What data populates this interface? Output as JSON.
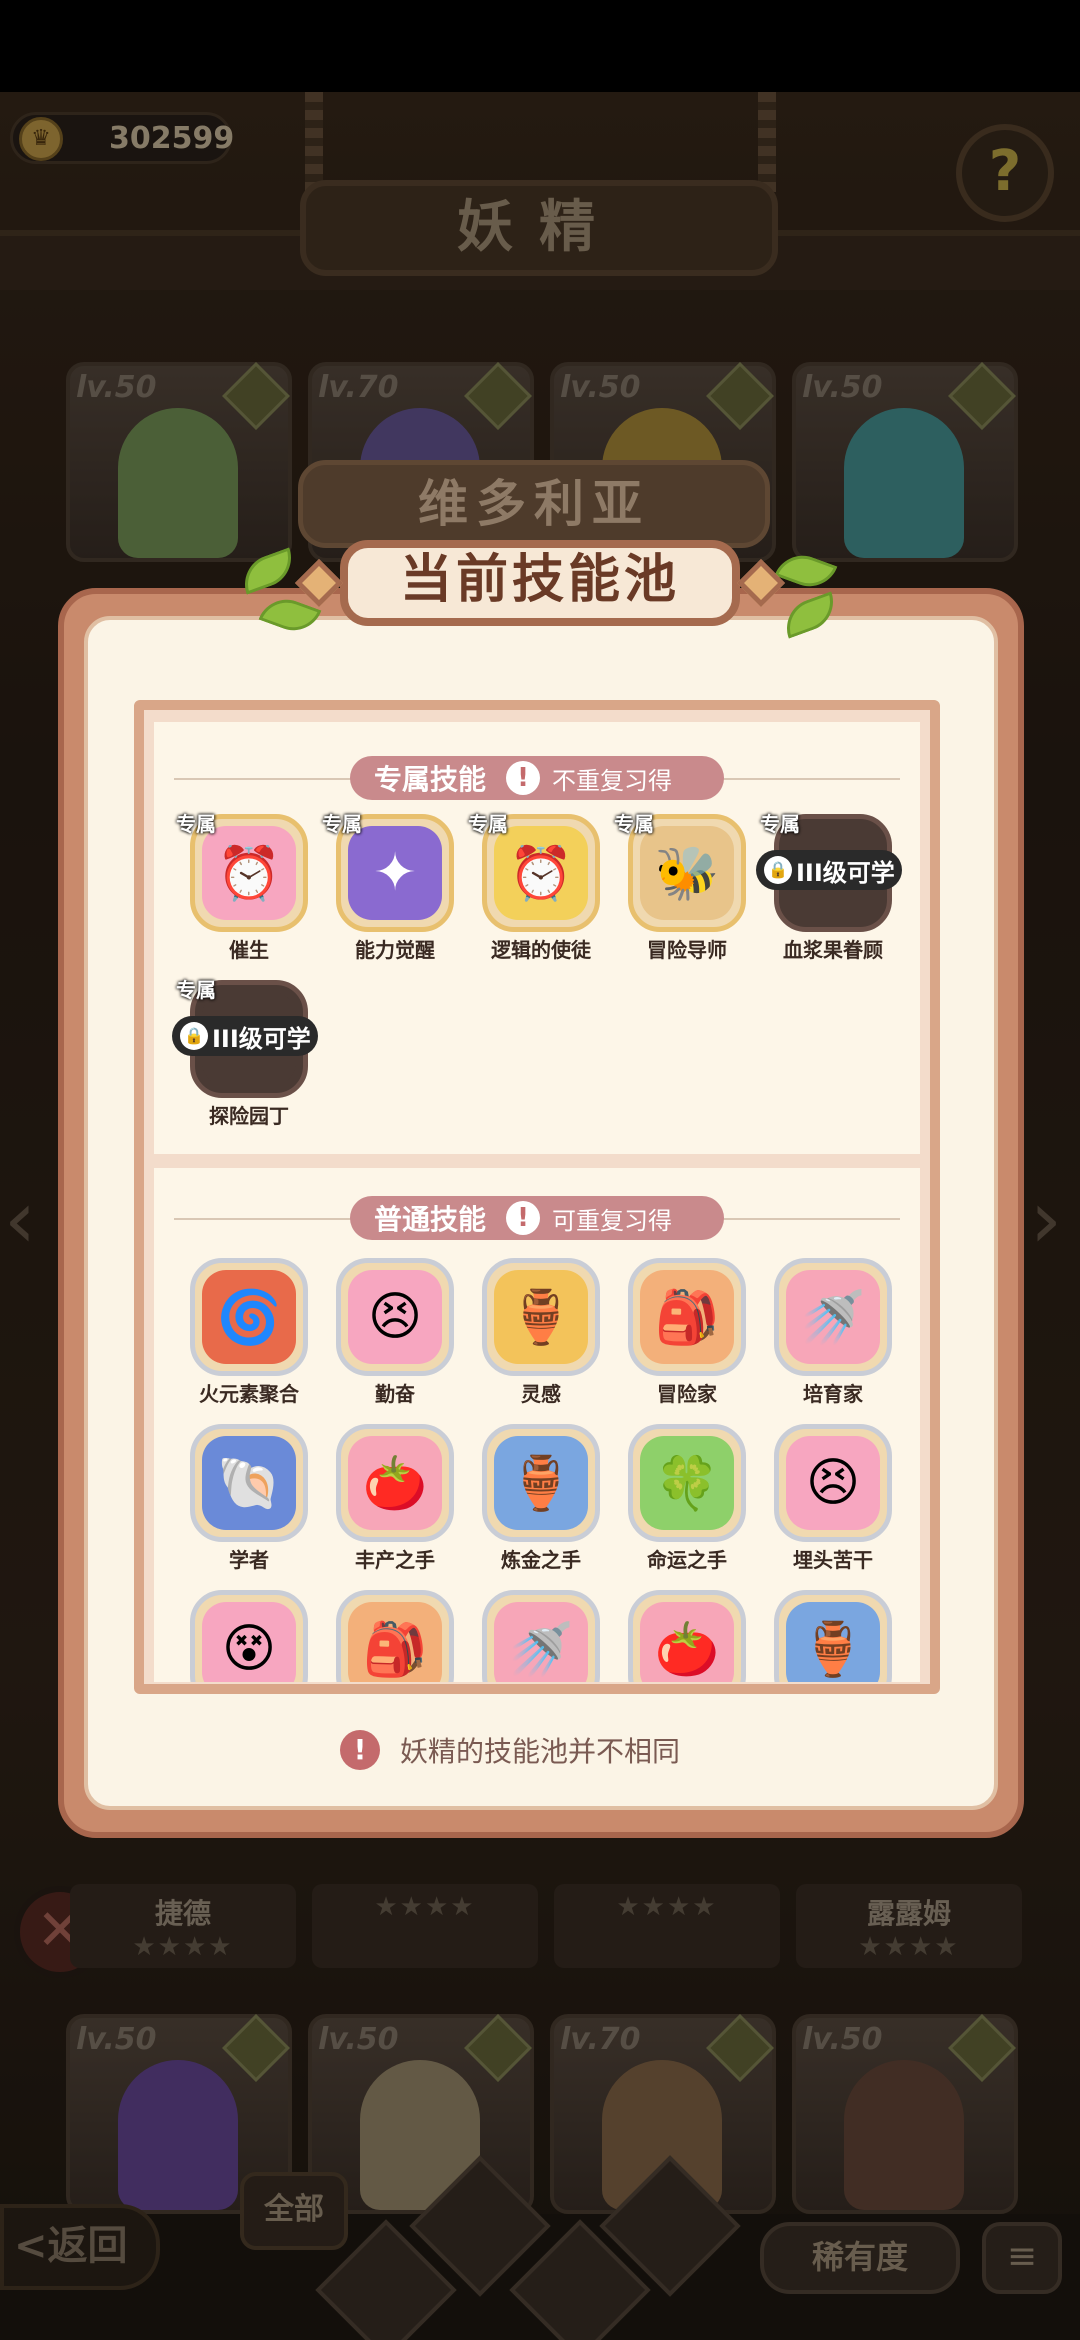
{
  "hud": {
    "coins": "302599",
    "page_title": "妖精"
  },
  "top_cards": [
    {
      "level": "lv.50"
    },
    {
      "level": "lv.70"
    },
    {
      "level": "lv.50"
    },
    {
      "level": "lv.50"
    }
  ],
  "bottom_cards": [
    {
      "level": "lv.50"
    },
    {
      "level": "lv.50"
    },
    {
      "level": "lv.70"
    },
    {
      "level": "lv.50"
    }
  ],
  "name_bars": [
    {
      "name": "捷德",
      "stars": "★★★★"
    },
    {
      "name": "",
      "stars": "★★★★"
    },
    {
      "name": "",
      "stars": "★★★★"
    },
    {
      "name": "露露姆",
      "stars": "★★★★"
    }
  ],
  "popup": {
    "character_name": "维多利亚",
    "title": "当前技能池",
    "exclusive": {
      "title": "专属技能",
      "note": "不重复习得",
      "tag": "专属",
      "lock_text": "III级可学",
      "skills": [
        {
          "label": "催生",
          "icon": "⏰",
          "bg": "#f7a6c0",
          "locked": false
        },
        {
          "label": "能力觉醒",
          "icon": "✦",
          "bg": "#8a6ad0",
          "locked": false
        },
        {
          "label": "逻辑的使徒",
          "icon": "⏰",
          "bg": "#f3d05a",
          "locked": false
        },
        {
          "label": "冒险导师",
          "icon": "🐝",
          "bg": "#e8c48a",
          "locked": false
        },
        {
          "label": "血浆果眷顾",
          "icon": "",
          "bg": "#4a3a34",
          "locked": true
        },
        {
          "label": "探险园丁",
          "icon": "",
          "bg": "#4a3a34",
          "locked": true
        }
      ]
    },
    "common": {
      "title": "普通技能",
      "note": "可重复习得",
      "skills": [
        {
          "label": "火元素聚合",
          "icon": "🌀",
          "bg": "#e86a4a"
        },
        {
          "label": "勤奋",
          "icon": "😣",
          "bg": "#f7a6c0"
        },
        {
          "label": "灵感",
          "icon": "🏺",
          "bg": "#f3c35a"
        },
        {
          "label": "冒险家",
          "icon": "🎒",
          "bg": "#f3b07a"
        },
        {
          "label": "培育家",
          "icon": "🚿",
          "bg": "#f7a6b8"
        },
        {
          "label": "学者",
          "icon": "🐚",
          "bg": "#6a8ad8"
        },
        {
          "label": "丰产之手",
          "icon": "🍅",
          "bg": "#f7a6b8"
        },
        {
          "label": "炼金之手",
          "icon": "🏺",
          "bg": "#7aa6e0"
        },
        {
          "label": "命运之手",
          "icon": "🍀",
          "bg": "#8ed06a"
        },
        {
          "label": "埋头苦干",
          "icon": "😣",
          "bg": "#f7a6c0"
        },
        {
          "label": "",
          "icon": "😵",
          "bg": "#f7a6c0"
        },
        {
          "label": "",
          "icon": "🎒",
          "bg": "#f3b07a"
        },
        {
          "label": "",
          "icon": "🚿",
          "bg": "#f7a6b8"
        },
        {
          "label": "",
          "icon": "🍅",
          "bg": "#f7a6b8"
        },
        {
          "label": "",
          "icon": "🏺",
          "bg": "#7aa6e0"
        }
      ]
    },
    "footer_note": "妖精的技能池并不相同"
  },
  "nav": {
    "back": "<返回",
    "all_tab": "全部",
    "rarity": "稀有度",
    "sort_icon": "≡"
  }
}
